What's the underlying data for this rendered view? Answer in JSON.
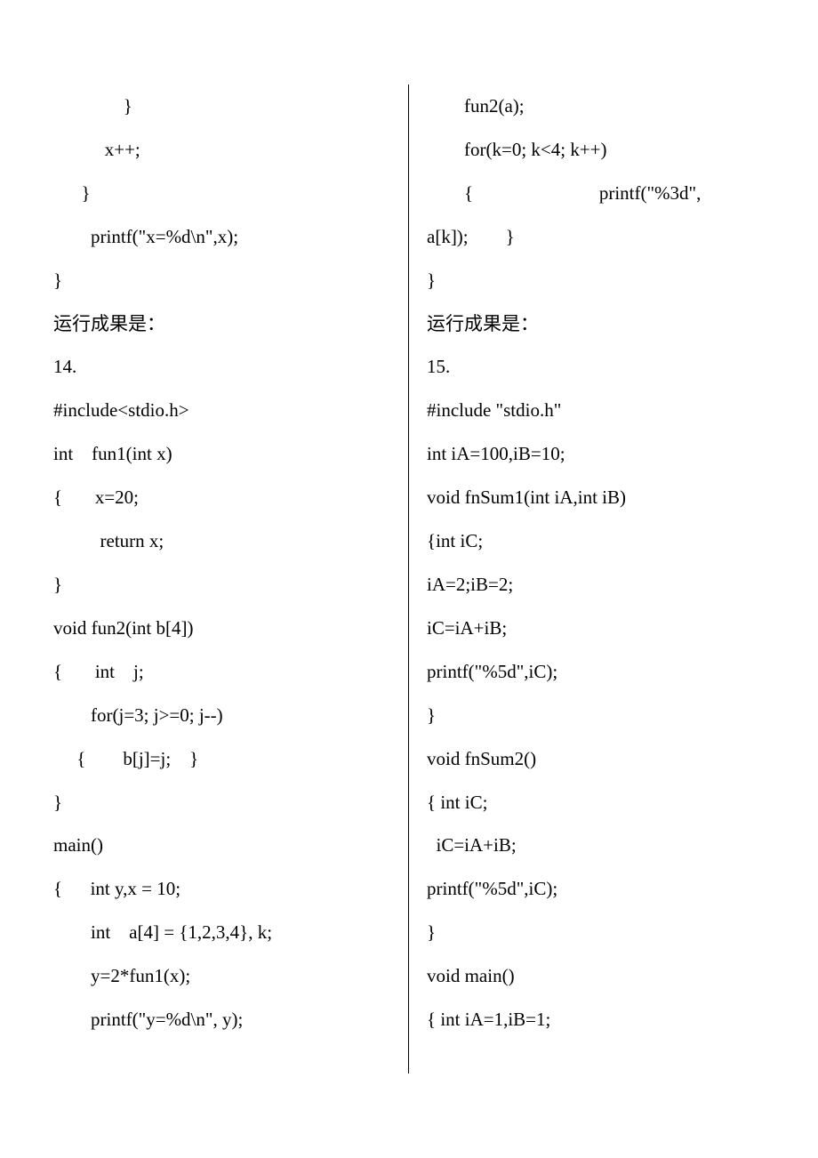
{
  "left": {
    "l1": "               }",
    "l2": "           x++;",
    "l3": "      }",
    "l4": "        printf(\"x=%d\\n\",x);",
    "l5": "}",
    "l6": "运行成果是：",
    "l7": "14.",
    "l8": "#include<stdio.h>",
    "l9": "int    fun1(int x)",
    "l10": "{       x=20;",
    "l11": "          return x;",
    "l12": "}",
    "l13": "void fun2(int b[4])",
    "l14": "{       int    j;",
    "l15": "        for(j=3; j>=0; j--)",
    "l16": "     {        b[j]=j;    }",
    "l17": "}",
    "l18": "main()",
    "l19": "{      int y,x = 10;",
    "l20": "        int    a[4] = {1,2,3,4}, k;",
    "l21": "        y=2*fun1(x);",
    "l22": "        printf(\"y=%d\\n\", y);"
  },
  "right": {
    "l1": "        fun2(a);",
    "l2": "        for(k=0; k<4; k++)",
    "l3a": "        {                           printf(\"%3d\",",
    "l3b": "a[k]);        }",
    "l4": "}",
    "l5": "运行成果是：",
    "l6": "15.",
    "l7": "#include \"stdio.h\"",
    "l8": "int iA=100,iB=10;",
    "l9": "void fnSum1(int iA,int iB)",
    "l10": "{int iC;",
    "l11": "iA=2;iB=2;",
    "l12": "iC=iA+iB;",
    "l13": "printf(\"%5d\",iC);",
    "l14": "}",
    "l15": "void fnSum2()",
    "l16": "{ int iC;",
    "l17": "  iC=iA+iB;",
    "l18": "printf(\"%5d\",iC);",
    "l19": "}",
    "l20": "void main()",
    "l21": "{ int iA=1,iB=1;"
  }
}
